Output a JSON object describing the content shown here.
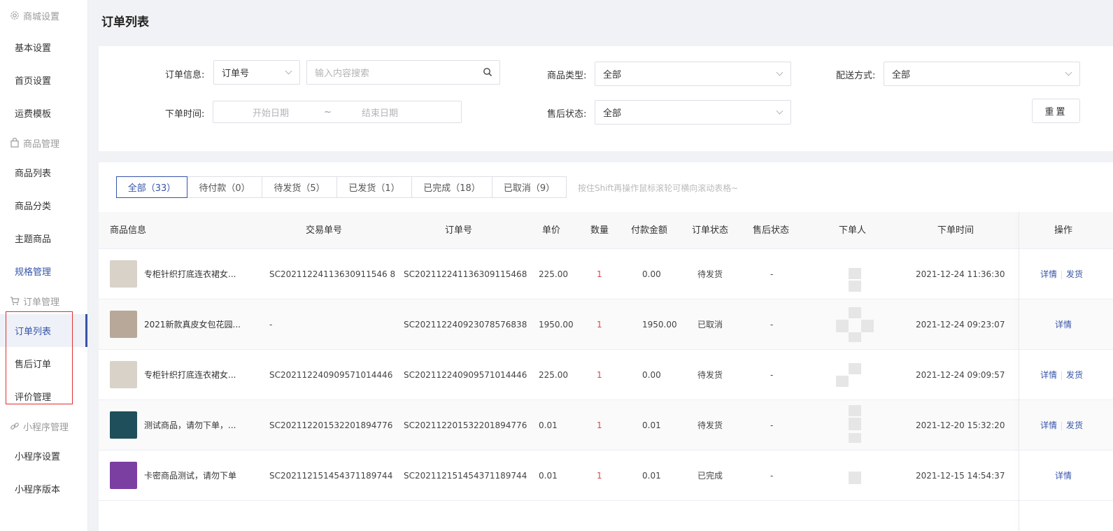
{
  "sidebar": {
    "groups": [
      {
        "title": "商城设置",
        "icon": "gear-icon",
        "items": [
          {
            "label": "基本设置"
          },
          {
            "label": "首页设置"
          },
          {
            "label": "运费模板"
          }
        ]
      },
      {
        "title": "商品管理",
        "icon": "bag-icon",
        "items": [
          {
            "label": "商品列表"
          },
          {
            "label": "商品分类"
          },
          {
            "label": "主题商品"
          },
          {
            "label": "规格管理"
          }
        ]
      },
      {
        "title": "订单管理",
        "icon": "cart-icon",
        "items": [
          {
            "label": "订单列表"
          },
          {
            "label": "售后订单"
          },
          {
            "label": "评价管理"
          }
        ]
      },
      {
        "title": "小程序管理",
        "icon": "link-icon",
        "items": [
          {
            "label": "小程序设置"
          },
          {
            "label": "小程序版本"
          }
        ]
      }
    ]
  },
  "page": {
    "title": "订单列表"
  },
  "filters": {
    "order_info_label": "订单信息:",
    "order_info_type": "订单号",
    "search_placeholder": "输入内容搜索",
    "goods_type_label": "商品类型:",
    "goods_type_value": "全部",
    "delivery_label": "配送方式:",
    "delivery_value": "全部",
    "order_time_label": "下单时间:",
    "start_placeholder": "开始日期",
    "date_sep": "~",
    "end_placeholder": "结束日期",
    "aftersale_label": "售后状态:",
    "aftersale_value": "全部",
    "reset_label": "重置"
  },
  "tabs": [
    {
      "label": "全部（33）",
      "active": true
    },
    {
      "label": "待付款（0）"
    },
    {
      "label": "待发货（5）"
    },
    {
      "label": "已发货（1）"
    },
    {
      "label": "已完成（18）"
    },
    {
      "label": "已取消（9）"
    }
  ],
  "hint": "按住Shift再操作鼠标滚轮可横向滚动表格~",
  "table": {
    "headers": {
      "goods": "商品信息",
      "trade_no": "交易单号",
      "order_no": "订单号",
      "price": "单价",
      "qty": "数量",
      "paid": "付款金额",
      "status": "订单状态",
      "aftersale": "售后状态",
      "buyer": "下单人",
      "time": "下单时间",
      "op": "操作"
    },
    "rows": [
      {
        "name": "专柜针织打底连衣裙女...",
        "thumb": "#d8d2c8",
        "trade_no": "SC20211224113630911546 8",
        "order_no": "SC202112241136309115468",
        "price": "225.00",
        "qty": "1",
        "paid": "0.00",
        "status": "待发货",
        "aftersale": "-",
        "time": "2021-12-24 11:36:30",
        "op1": "详情",
        "op2": "发货"
      },
      {
        "name": "2021新款真皮女包花园...",
        "thumb": "#b8a89a",
        "trade_no": "-",
        "order_no": "SC202112240923078576838",
        "price": "1950.00",
        "qty": "1",
        "paid": "1950.00",
        "status": "已取消",
        "aftersale": "-",
        "time": "2021-12-24 09:23:07",
        "op1": "详情",
        "op2": ""
      },
      {
        "name": "专柜针织打底连衣裙女...",
        "thumb": "#d8d2c8",
        "trade_no": "SC202112240909571014446",
        "order_no": "SC202112240909571014446",
        "price": "225.00",
        "qty": "1",
        "paid": "0.00",
        "status": "待发货",
        "aftersale": "-",
        "time": "2021-12-24 09:09:57",
        "op1": "详情",
        "op2": "发货"
      },
      {
        "name": "测试商品，请勿下单，...",
        "thumb": "#1f4f5a",
        "trade_no": "SC202112201532201894776",
        "order_no": "SC202112201532201894776",
        "price": "0.01",
        "qty": "1",
        "paid": "0.01",
        "status": "待发货",
        "aftersale": "-",
        "time": "2021-12-20 15:32:20",
        "op1": "详情",
        "op2": "发货"
      },
      {
        "name": "卡密商品测试，请勿下单",
        "thumb": "#7a3fa0",
        "trade_no": "SC202112151454371189744",
        "order_no": "SC202112151454371189744",
        "price": "0.01",
        "qty": "1",
        "paid": "0.01",
        "status": "已完成",
        "aftersale": "-",
        "time": "2021-12-15 14:54:37",
        "op1": "详情",
        "op2": ""
      }
    ]
  },
  "colors": {
    "accent": "#3654a8",
    "qty_red": "#d9464a",
    "highlight_box": "#e03030"
  }
}
